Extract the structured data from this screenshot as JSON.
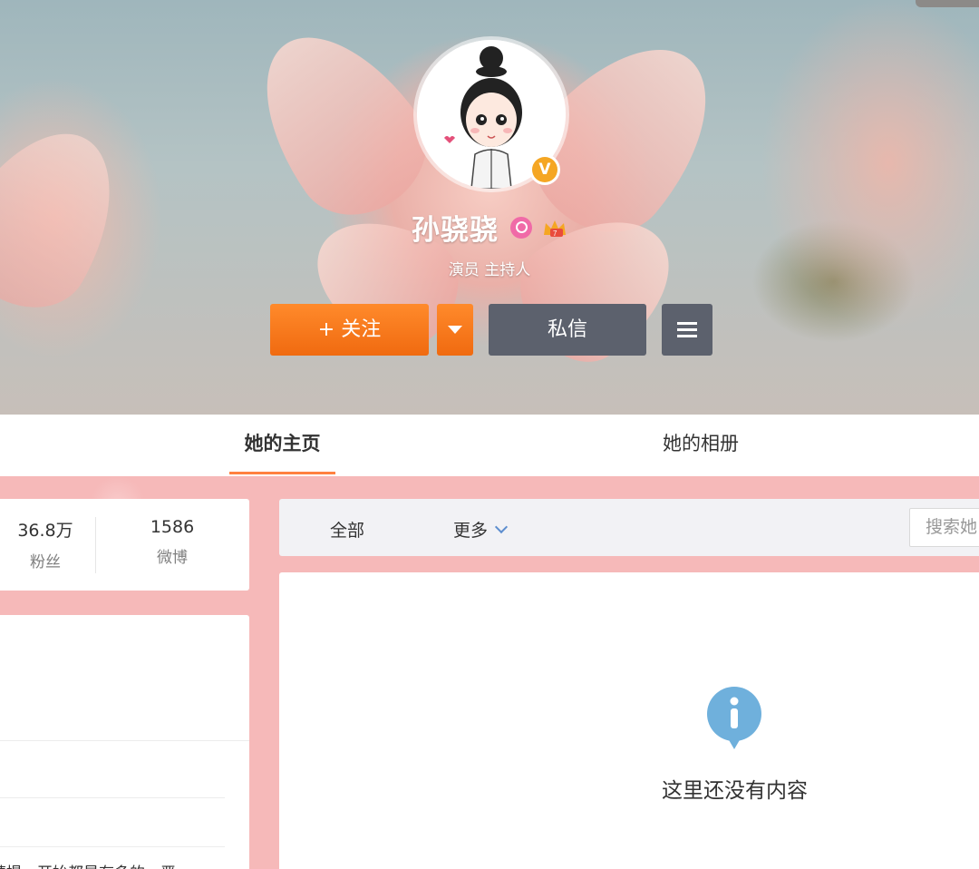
{
  "profile": {
    "name": "孙骁骁",
    "description": "演员 主持人",
    "verify_badge": "V",
    "icons": [
      "verified-icon",
      "female-icon",
      "vip-crown-icon"
    ]
  },
  "actions": {
    "follow_label": "+ 关注",
    "message_label": "私信"
  },
  "tabs": [
    {
      "label": "她的主页",
      "active": true
    },
    {
      "label": "她的相册",
      "active": false
    }
  ],
  "stats": {
    "fans_value": "36.8万",
    "fans_label": "粉丝",
    "posts_value": "1586",
    "posts_label": "微博"
  },
  "left_card": {
    "snippet": "精提，开始都是有多的，严"
  },
  "feed": {
    "filter_all": "全部",
    "filter_more": "更多",
    "search_placeholder": "搜索她",
    "empty_text": "这里还没有内容"
  },
  "colors": {
    "accent_orange": "#f06a10",
    "dark_button": "#5c616d",
    "page_pink": "#f6b9b9",
    "info_blue": "#6fb0dc"
  }
}
